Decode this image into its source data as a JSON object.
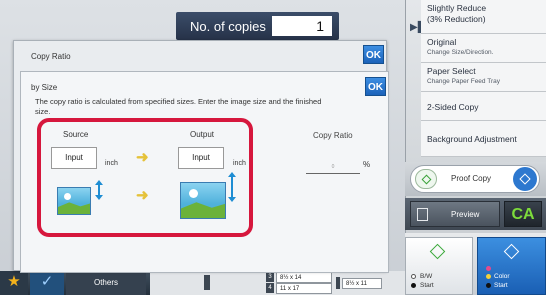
{
  "copies": {
    "label": "No. of copies",
    "value": "1"
  },
  "side_panel": {
    "items": [
      {
        "title": "Slightly Reduce",
        "subtitle": "(3% Reduction)"
      },
      {
        "title": "Original",
        "subtitle": "Change Size/Direction."
      },
      {
        "title": "Paper Select",
        "subtitle": "Change Paper Feed Tray"
      },
      {
        "title": "2-Sided Copy",
        "subtitle": ""
      },
      {
        "title": "Background Adjustment",
        "subtitle": ""
      }
    ],
    "proof_copy_label": "Proof Copy",
    "preview_label": "Preview",
    "ca_label": "CA",
    "bw_start_label": "B/W\nStart",
    "color_start_label": "Color\nStart"
  },
  "bottom_bar": {
    "others_label": "Others",
    "trays": [
      {
        "num": "3",
        "size": "8½ x 14"
      },
      {
        "num": "4",
        "size": "11 x 17"
      }
    ],
    "extra_tray": "8½ x 11"
  },
  "dialog": {
    "outer_title": "Copy Ratio",
    "ok_label": "OK",
    "inner_title": "by Size",
    "description": "The copy ratio is calculated from specified sizes. Enter the image size and the finished size.",
    "source_label": "Source",
    "output_label": "Output",
    "ratio_label": "Copy Ratio",
    "input_label": "Input",
    "unit": "inch",
    "ratio_placeholder": "0",
    "percent": "%"
  },
  "colors": {
    "highlight": "#d6173d",
    "accent_blue": "#2d78cf",
    "arrow_yellow": "#e5c23a"
  },
  "icons": [
    "image-icon",
    "resize-arrow-icon",
    "star-icon",
    "check-icon",
    "diamond-icon"
  ]
}
